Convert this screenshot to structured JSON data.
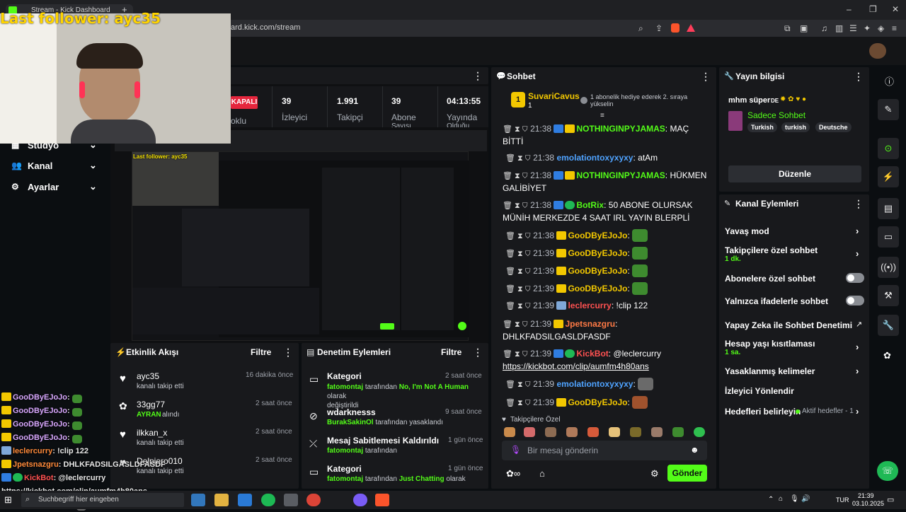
{
  "browser": {
    "tab_title": "Stream - Kick Dashboard",
    "new_tab": "+",
    "url": "ard.kick.com/stream",
    "window_controls": [
      "–",
      "❐",
      "✕"
    ]
  },
  "overlay": {
    "last_follower": "Last follower: ayc35"
  },
  "nav": {
    "items": [
      {
        "label": "Stüdyo"
      },
      {
        "label": "Kanal"
      },
      {
        "label": "Ayarlar"
      }
    ]
  },
  "stats": {
    "status": "KAPALI",
    "status_sub": "oklu",
    "items": [
      {
        "value": "39",
        "label": "İzleyici"
      },
      {
        "value": "1.991",
        "label": "Takipçi"
      },
      {
        "value": "39",
        "label": "Abone"
      },
      {
        "value": "04:13:55",
        "label": "Yayında"
      }
    ],
    "extra_labels": [
      "Sayısı",
      "Olduğu"
    ]
  },
  "activity": {
    "title": "Etkinlik Akışı",
    "filter": "Filtre",
    "items": [
      {
        "name": "ayc35",
        "desc": "kanalı takip etti",
        "time": "16 dakika önce",
        "icon": "heart-icon"
      },
      {
        "name": "33gg77",
        "desc_highlight": "AYRAN",
        "desc": "alındı",
        "time": "2 saat önce",
        "icon": "kick-icon"
      },
      {
        "name": "ilkkan_x",
        "desc": "kanalı takip etti",
        "time": "2 saat önce",
        "icon": "heart-icon"
      },
      {
        "name": "Delpiero010",
        "desc": "kanalı takip etti",
        "time": "2 saat önce",
        "icon": "heart-icon"
      }
    ]
  },
  "moderation": {
    "title": "Denetim Eylemleri",
    "filter": "Filtre",
    "items": [
      {
        "title": "Kategori",
        "user": "fatomontaj",
        "text": "tarafından",
        "highlight": "No, I'm Not A Human",
        "tail": "olarak",
        "line2": "değiştirildi",
        "time": "2 saat önce"
      },
      {
        "title": "wdarknesss",
        "user": "BurakSakinOl",
        "text": "tarafından yasaklandı",
        "time": "9 saat önce"
      },
      {
        "title": "Mesaj Sabitlemesi Kaldırıldı",
        "user": "fatomontaj",
        "text": "tarafından",
        "time": "1 gün önce"
      },
      {
        "title": "Kategori",
        "user": "fatomontaj",
        "text": "tarafından",
        "highlight": "Just Chatting",
        "tail": "olarak",
        "time": "1 gün önce"
      }
    ]
  },
  "chat": {
    "title": "Sohbet",
    "pinned_user": "SuvariCavus",
    "pinned_count": "1",
    "gift_text": "1 abonelik hediye ederek 2. sıraya yükselin",
    "messages": [
      {
        "time": "21:38",
        "user": "NOTHINGINPYJAMAS",
        "text": ": MAÇ BİTTİ"
      },
      {
        "time": "21:38",
        "user": "emolationtoxyxyxy",
        "text": ": atAm"
      },
      {
        "time": "21:38",
        "user": "NOTHINGINPYJAMAS",
        "text": ": HÜKMEN GALİBİYET"
      },
      {
        "time": "21:38",
        "user": "BotRix",
        "text": ": 50 ABONE OLURSAK MÜNİH MERKEZDE 4 SAAT IRL YAYIN BLERPLİ"
      },
      {
        "time": "21:38",
        "user": "GooDByEJoJo",
        "text": ":"
      },
      {
        "time": "21:39",
        "user": "GooDByEJoJo",
        "text": ":"
      },
      {
        "time": "21:39",
        "user": "GooDByEJoJo",
        "text": ":"
      },
      {
        "time": "21:39",
        "user": "GooDByEJoJo",
        "text": ":"
      },
      {
        "time": "21:39",
        "user": "leclercurry",
        "text": ": !clip 122"
      },
      {
        "time": "21:39",
        "user": "Jpetsnazgru",
        "text": ": DHLKFADSILGASLDFASDF"
      },
      {
        "time": "21:39",
        "user": "KickBot",
        "text": ": @leclercurry",
        "link": "https://kickbot.com/clip/aumfm4h80ans"
      },
      {
        "time": "21:39",
        "user": "emolationtoxyxyxy",
        "text": ":"
      },
      {
        "time": "21:39",
        "user": "GooDByEJoJo",
        "text": ":"
      }
    ],
    "followers_only": "Takipçilere Özel",
    "input_placeholder": "Bir mesaj gönderin",
    "send": "Gönder"
  },
  "stream_info": {
    "title": "Yayın bilgisi",
    "stream_title": "mhm süper",
    "stream_title_lang": "DE",
    "category": "Sadece Sohbet",
    "tags": [
      "Turkish",
      "turkish",
      "Deutsche"
    ],
    "edit": "Düzenle"
  },
  "channel_actions": {
    "title": "Kanal Eylemleri",
    "items": [
      {
        "label": "Yavaş mod",
        "control": "chevron"
      },
      {
        "label": "Takipçilere özel sohbet",
        "sub": "1 dk.",
        "control": "chevron"
      },
      {
        "label": "Abonelere özel sohbet",
        "control": "toggle",
        "enabled": false
      },
      {
        "label": "Yalnızca ifadelerle sohbet",
        "control": "toggle",
        "enabled": false
      },
      {
        "label": "Yapay Zeka ile Sohbet Denetimi",
        "control": "external"
      },
      {
        "label": "Hesap yaşı kısıtlaması",
        "sub": "1 sa.",
        "control": "chevron"
      },
      {
        "label": "Yasaklanmış kelimeler",
        "control": "chevron"
      },
      {
        "label": "İzleyici Yönlendir",
        "control": "none"
      },
      {
        "label": "Hedefleri belirleyin",
        "sub_inline": "Aktif hedefler - 1",
        "control": "chevron"
      }
    ]
  },
  "overlay_chat": [
    {
      "user": "GooDByEJoJo",
      "text": ":"
    },
    {
      "user": "GooDByEJoJo",
      "text": ":"
    },
    {
      "user": "GooDByEJoJo",
      "text": ":"
    },
    {
      "user": "GooDByEJoJo",
      "text": ":"
    },
    {
      "user": "leclercurry",
      "text": ": !clip 122"
    },
    {
      "user": "Jpetsnazgru",
      "text": ": DHLKFADSILGASLDFASDF"
    },
    {
      "user": "KickBot",
      "text": ": @leclercurry https://kickbot.com/clip/aumfm4h80ans"
    },
    {
      "user": "emolationtoxyxyxy",
      "text": ":"
    },
    {
      "user": "GooDByEJoJo",
      "text": ""
    }
  ],
  "taskbar": {
    "search_placeholder": "Suchbegriff hier eingeben",
    "lang": "TUR",
    "time": "21:39",
    "date": "03.10.2025"
  },
  "colors": {
    "kick_green": "#53fc18",
    "panel": "#18191c",
    "background": "#0b0e11",
    "live_red": "#e5263d"
  }
}
